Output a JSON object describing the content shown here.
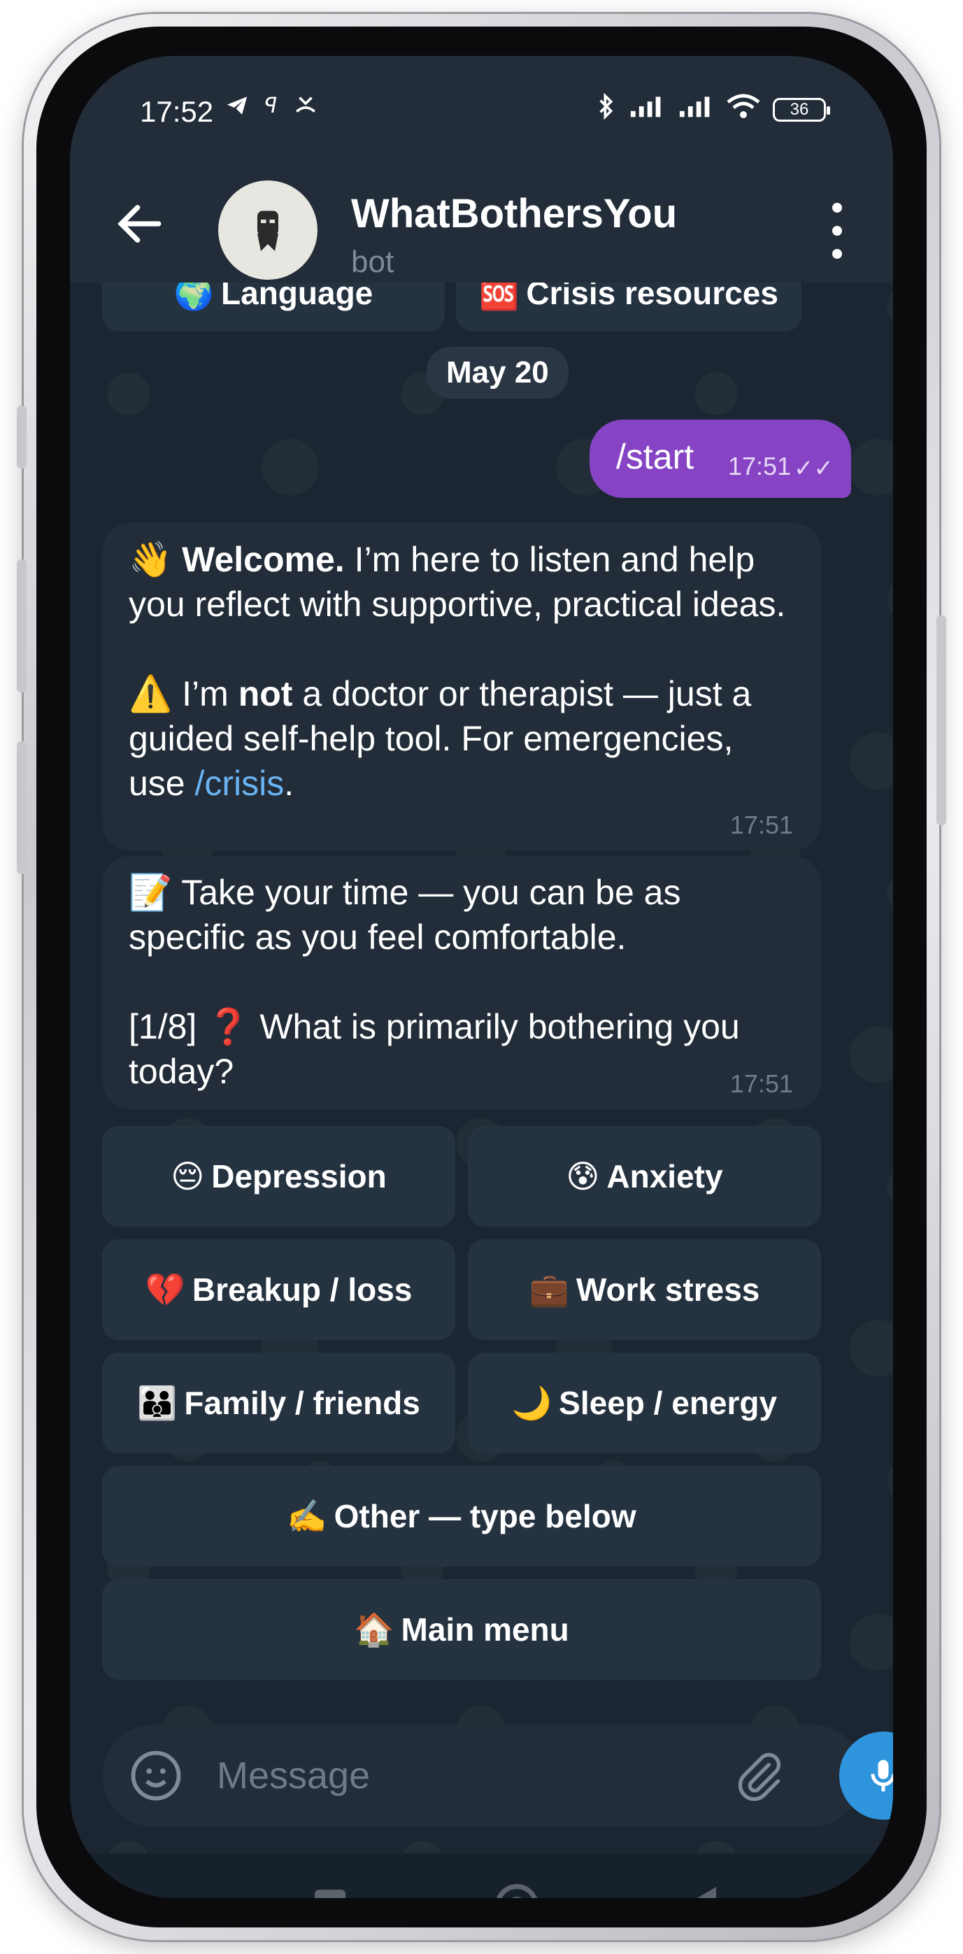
{
  "status_bar": {
    "time": "17:52",
    "battery": "36",
    "left_icons": [
      "telegram-icon",
      "signal-alt-icon",
      "missed-call-icon"
    ],
    "right_icons": [
      "bluetooth-icon",
      "signal-icon",
      "signal-icon",
      "wifi-icon",
      "battery-icon"
    ]
  },
  "header": {
    "title": "WhatBothersYou",
    "subtitle": "bot"
  },
  "top_keyboard": [
    {
      "emoji": "🌍",
      "label": "Language"
    },
    {
      "emoji": "🆘",
      "label": "Crisis resources"
    }
  ],
  "date_separator": "May 20",
  "outgoing": {
    "text": "/start",
    "time": "17:51",
    "status": "✓✓"
  },
  "messages": [
    {
      "p1_emoji": "👋",
      "p1_bold": "Welcome.",
      "p1_rest": " I’m here to listen and help you reflect with supportive, practical ideas.",
      "p2_emoji": "⚠️",
      "p2_a": " I’m ",
      "p2_bold": "not",
      "p2_b": " a doctor or therapist — just a guided self-help tool. For emergencies, use ",
      "p2_link": "/crisis",
      "p2_end": ".",
      "time": "17:51"
    },
    {
      "p1_emoji": "📝",
      "p1_text": " Take your time — you can be as specific as you feel comfortable.",
      "p2_prefix": "[1/8] ",
      "p2_emoji": "❓",
      "p2_text": " What is primarily bothering you today?",
      "time": "17:51"
    }
  ],
  "keyboard": [
    {
      "emoji": "😔",
      "label": "Depression"
    },
    {
      "emoji": "😰",
      "label": "Anxiety"
    },
    {
      "emoji": "💔",
      "label": "Breakup / loss"
    },
    {
      "emoji": "💼",
      "label": "Work stress"
    },
    {
      "emoji": "👪",
      "label": "Family / friends"
    },
    {
      "emoji": "🌙",
      "label": "Sleep / energy"
    },
    {
      "emoji": "✍️",
      "label": "Other — type below"
    },
    {
      "emoji": "🏠",
      "label": "Main menu"
    }
  ],
  "composer": {
    "placeholder": "Message"
  },
  "colors": {
    "header_bg": "#222d39",
    "outgoing_bubble": "#8644c4",
    "incoming_bubble": "#222d39",
    "link": "#6ab3f3",
    "mic_button": "#2e95dd"
  }
}
